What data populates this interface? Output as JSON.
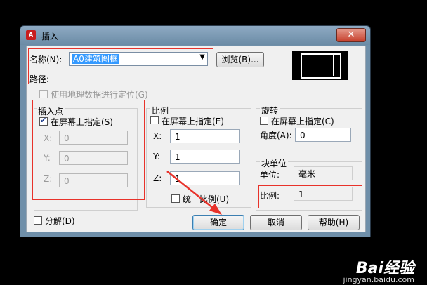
{
  "window": {
    "title": "插入",
    "app_icon": "autocad-icon",
    "close": "✕"
  },
  "name": {
    "label": "名称(N):",
    "value": "A0建筑图框",
    "browse_label": "浏览(B)..."
  },
  "path": {
    "label": "路径:"
  },
  "geo": {
    "label": "使用地理数据进行定位(G)"
  },
  "insertion": {
    "title": "插入点",
    "onscreen_label": "在屏幕上指定(S)",
    "x_label": "X:",
    "x_value": "0",
    "y_label": "Y:",
    "y_value": "0",
    "z_label": "Z:",
    "z_value": "0"
  },
  "scale": {
    "title": "比例",
    "onscreen_label": "在屏幕上指定(E)",
    "x_label": "X:",
    "x_value": "1",
    "y_label": "Y:",
    "y_value": "1",
    "z_label": "Z:",
    "z_value": "1",
    "uniform_label": "统一比例(U)"
  },
  "rotation": {
    "title": "旋转",
    "onscreen_label": "在屏幕上指定(C)",
    "angle_label": "角度(A):",
    "angle_value": "0"
  },
  "block_unit": {
    "title": "块单位",
    "unit_label": "单位:",
    "unit_value": "毫米",
    "factor_label": "比例:",
    "factor_value": "1"
  },
  "explode": {
    "label": "分解(D)"
  },
  "buttons": {
    "ok": "确定",
    "cancel": "取消",
    "help": "帮助(H)"
  },
  "watermark": {
    "brand": "Bai经验",
    "url": "jingyan.baidu.com"
  },
  "colors": {
    "annotation_red": "#e8322a",
    "selection": "#3399ff"
  }
}
